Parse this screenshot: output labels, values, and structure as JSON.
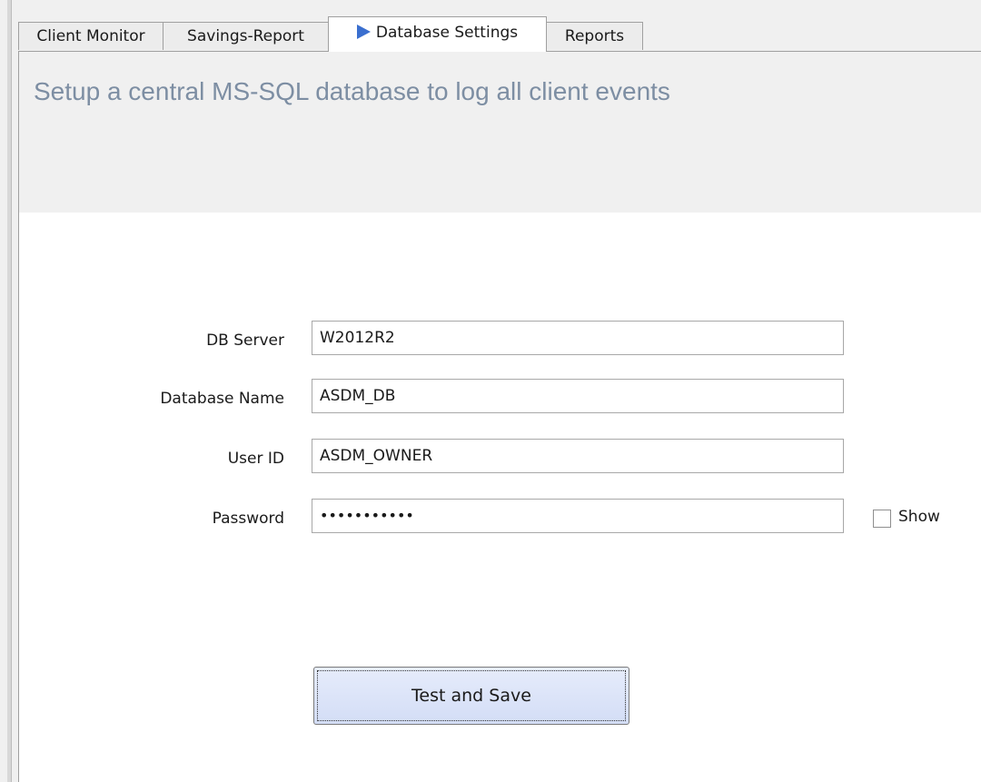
{
  "tabs": [
    {
      "label": "Client Monitor",
      "active": false
    },
    {
      "label": "Savings-Report",
      "active": false
    },
    {
      "label": "Database Settings",
      "active": true,
      "icon": "play-arrow-icon"
    },
    {
      "label": "Reports",
      "active": false
    }
  ],
  "header": {
    "title": "Setup a central MS-SQL database to log all client events"
  },
  "form": {
    "db_server": {
      "label": "DB Server",
      "value": "W2012R2"
    },
    "database_name": {
      "label": "Database Name",
      "value": "ASDM_DB"
    },
    "user_id": {
      "label": "User ID",
      "value": "ASDM_OWNER"
    },
    "password": {
      "label": "Password",
      "value": "•••••••••••"
    },
    "show_password": {
      "label": "Show",
      "checked": false
    }
  },
  "actions": {
    "test_and_save_label": "Test and Save"
  },
  "colors": {
    "accent": "#3a6fcf",
    "headline": "#7d8ea3",
    "button_fill": "#d3ddf6"
  }
}
